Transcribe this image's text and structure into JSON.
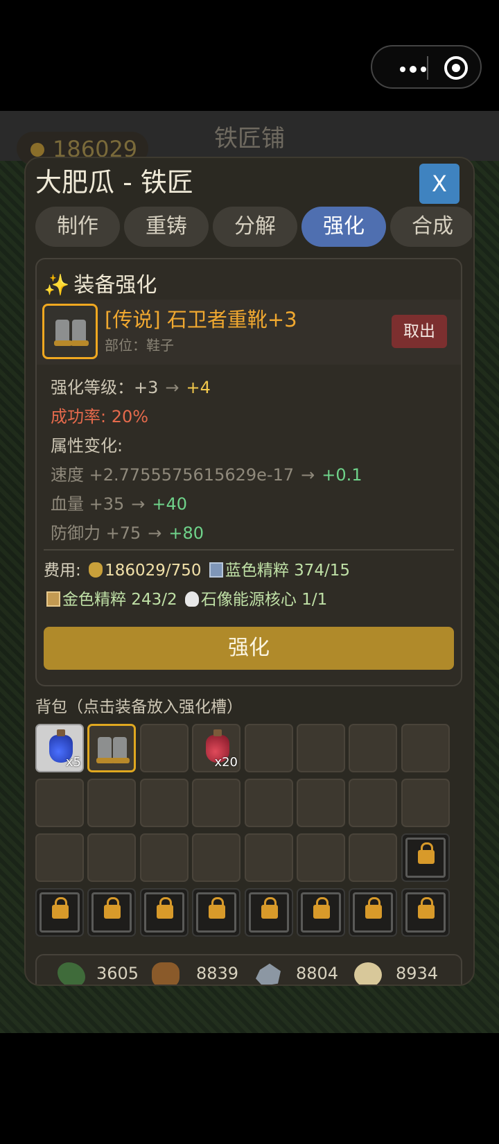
{
  "game": {
    "shop_title": "铁匠铺",
    "gold_amount": "186029"
  },
  "modal": {
    "title": "大肥瓜 - 铁匠",
    "close_label": "X",
    "tabs": [
      {
        "label": "制作",
        "active": false
      },
      {
        "label": "重铸",
        "active": false
      },
      {
        "label": "分解",
        "active": false
      },
      {
        "label": "强化",
        "active": true
      },
      {
        "label": "合成",
        "active": false
      }
    ]
  },
  "enhance": {
    "panel_title": "装备强化",
    "title_icon": "sparkles-icon",
    "item": {
      "name": "[传说] 石卫者重靴+3",
      "part_label": "部位：鞋子",
      "icon": "boots-icon",
      "rarity_color": "#f0a830"
    },
    "take_out_label": "取出",
    "level_label": "强化等级：",
    "level_from": "+3",
    "level_to": "+4",
    "success_rate": "成功率: 20%",
    "attr_change_label": "属性变化:",
    "attributes": [
      {
        "name": "速度",
        "from": "+2.7755575615629e-17",
        "to": "+0.1"
      },
      {
        "name": "血量",
        "from": "+35",
        "to": "+40"
      },
      {
        "name": "防御力",
        "from": "+75",
        "to": "+80"
      }
    ],
    "cost_label": "费用:",
    "costs": [
      {
        "icon": "money-bag-icon",
        "text": "186029/750"
      },
      {
        "icon": "blue-essence-icon",
        "text": "蓝色精粹 374/15"
      },
      {
        "icon": "gold-essence-icon",
        "text": "金色精粹 243/2"
      },
      {
        "icon": "skull-icon",
        "text": "石像能源核心 1/1"
      }
    ],
    "button_label": "强化",
    "button_color": "#b08a2a"
  },
  "backpack": {
    "title": "背包（点击装备放入强化槽）",
    "slots": [
      {
        "item": "blue-potion",
        "qty": "x5"
      },
      {
        "item": "boots",
        "qty": "",
        "selected": true
      },
      {
        "item": "",
        "qty": ""
      },
      {
        "item": "red-potion",
        "qty": "x20"
      },
      {
        "item": "",
        "qty": ""
      },
      {
        "item": "",
        "qty": ""
      },
      {
        "item": "",
        "qty": ""
      },
      {
        "item": "",
        "qty": ""
      },
      {
        "item": "",
        "qty": ""
      },
      {
        "item": "",
        "qty": ""
      },
      {
        "item": "",
        "qty": ""
      },
      {
        "item": "",
        "qty": ""
      },
      {
        "item": "",
        "qty": ""
      },
      {
        "item": "",
        "qty": ""
      },
      {
        "item": "",
        "qty": ""
      },
      {
        "item": "",
        "qty": ""
      },
      {
        "item": "",
        "qty": ""
      },
      {
        "item": "",
        "qty": ""
      },
      {
        "item": "",
        "qty": ""
      },
      {
        "item": "",
        "qty": ""
      },
      {
        "item": "",
        "qty": ""
      },
      {
        "item": "",
        "qty": ""
      },
      {
        "item": "",
        "qty": ""
      },
      {
        "item": "locked",
        "qty": ""
      },
      {
        "item": "locked",
        "qty": ""
      },
      {
        "item": "locked",
        "qty": ""
      },
      {
        "item": "locked",
        "qty": ""
      },
      {
        "item": "locked",
        "qty": ""
      },
      {
        "item": "locked",
        "qty": ""
      },
      {
        "item": "locked",
        "qty": ""
      },
      {
        "item": "locked",
        "qty": ""
      },
      {
        "item": "locked",
        "qty": ""
      }
    ]
  },
  "resources": [
    {
      "icon": "herb-icon",
      "amount": "3605"
    },
    {
      "icon": "wood-log-icon",
      "amount": "8839"
    },
    {
      "icon": "ore-icon",
      "amount": "8804"
    },
    {
      "icon": "cloth-icon",
      "amount": "8934"
    }
  ]
}
